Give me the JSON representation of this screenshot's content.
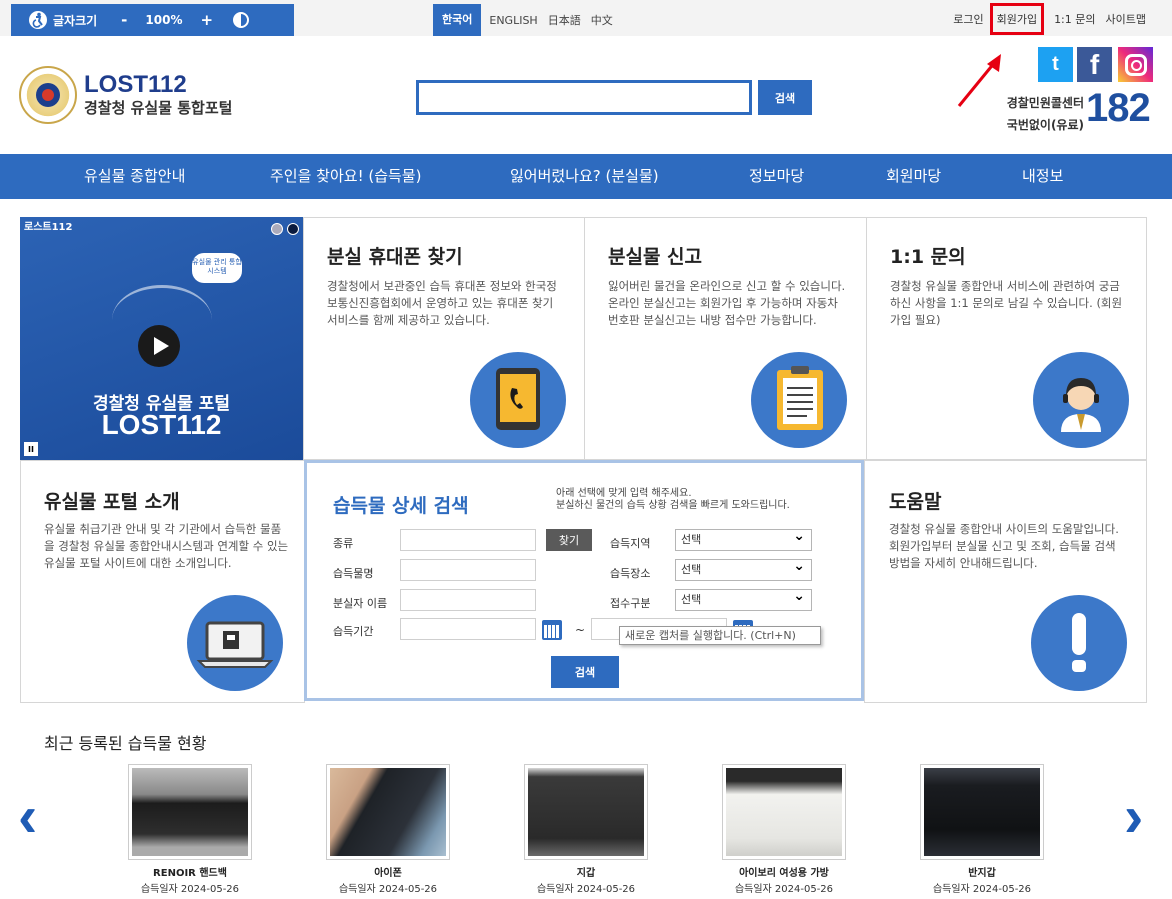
{
  "accessibility": {
    "font_size_label": "글자크기",
    "minus": "-",
    "zoom": "100%",
    "plus": "+"
  },
  "languages": [
    "한국어",
    "ENGLISH",
    "日本語",
    "中文"
  ],
  "top_links": [
    "로그인",
    "회원가입",
    "1:1 문의",
    "사이트맵"
  ],
  "header": {
    "brand_main": "LOST112",
    "brand_sub": "경찰청 유실물 통합포털",
    "search_placeholder": "",
    "search_button": "검색",
    "call_center_label": "경찰민원콜센터",
    "call_center_note": "국번없이(유료)",
    "call_center_number": "182",
    "social": {
      "twitter": "t",
      "facebook": "f"
    }
  },
  "nav": [
    "유실물 종합안내",
    "주인을 찾아요! (습득물)",
    "잃어버렸나요? (분실물)",
    "정보마당",
    "회원마당",
    "내정보"
  ],
  "banner": {
    "tag": "로스트112",
    "bubble": "유실물 관리 통합 시스템",
    "title": "경찰청 유실물 포털",
    "subtitle": "LOST112"
  },
  "cards": {
    "phone": {
      "title": "분실 휴대폰 찾기",
      "text": "경찰청에서 보관중인 습득 휴대폰 정보와 한국정보통신진흥협회에서 운영하고 있는 휴대폰 찾기 서비스를 함께 제공하고 있습니다."
    },
    "report": {
      "title": "분실물 신고",
      "text": "잃어버린 물건을 온라인으로 신고 할 수 있습니다. 온라인 분실신고는 회원가입 후 가능하며 자동차 번호판 분실신고는 내방 접수만 가능합니다."
    },
    "inquiry": {
      "title": "1:1 문의",
      "text": "경찰청 유실물 종합안내 서비스에 관련하여 궁금하신 사항을 1:1 문의로 남길 수 있습니다. (회원가입 필요)"
    },
    "intro": {
      "title": "유실물 포털 소개",
      "text": "유실물 취급기관 안내 및 각 기관에서 습득한 물품을 경찰청 유실물 종합안내시스템과 연계할 수 있는 유실물 포털 사이트에 대한 소개입니다."
    },
    "help": {
      "title": "도움말",
      "text": "경찰청 유실물 종합안내 사이트의 도움말입니다. 회원가입부터 분실물 신고 및 조회, 습득물 검색 방법을 자세히 안내해드립니다."
    }
  },
  "detail_search": {
    "title": "습득물 상세 검색",
    "desc_line1": "아래 선택에 맞게 입력 해주세요.",
    "desc_line2": "분실하신 물건의 습득 상황 검색을 빠르게 도와드립니다.",
    "labels": {
      "type": "종류",
      "item_name": "습득물명",
      "owner_name": "분실자 이름",
      "period": "습득기간",
      "region": "습득지역",
      "place": "습득장소",
      "category": "접수구분"
    },
    "find_button": "찾기",
    "select_value": "선택",
    "tilde": "~",
    "tooltip": "새로운 캡처를 실행합니다. (Ctrl+N)",
    "search_button": "검색"
  },
  "recent": {
    "title": "최근 등록된 습득물 현황",
    "prev": "‹",
    "next": "›",
    "items": [
      {
        "name": "RENOIR 핸드백",
        "date": "습득일자 2024-05-26"
      },
      {
        "name": "아이폰",
        "date": "습득일자 2024-05-26"
      },
      {
        "name": "지갑",
        "date": "습득일자 2024-05-26"
      },
      {
        "name": "아이보리 여성용 가방",
        "date": "습득일자 2024-05-26"
      },
      {
        "name": "반지갑",
        "date": "습득일자 2024-05-26"
      }
    ]
  },
  "colors": {
    "primary": "#2e6bbf",
    "highlight": "#e60012",
    "circle": "#3c78c9"
  }
}
